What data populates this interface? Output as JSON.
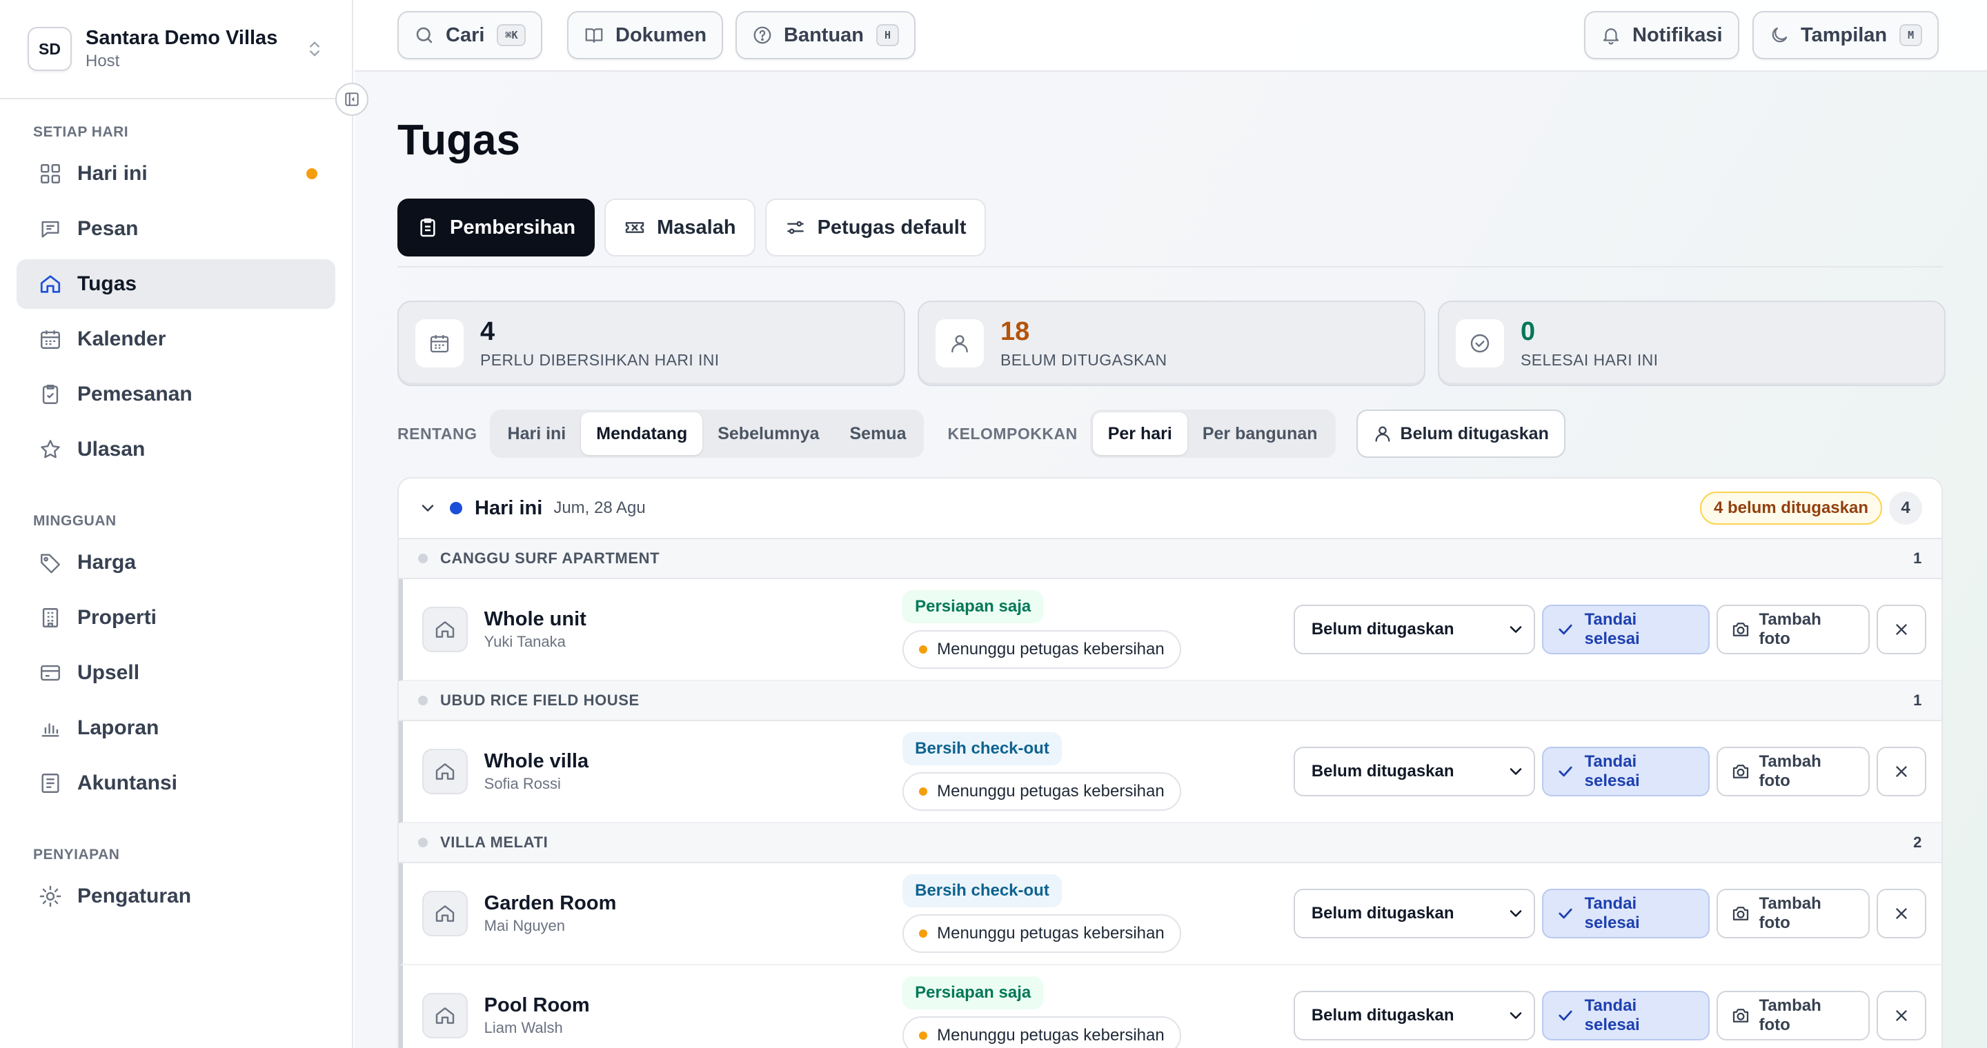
{
  "workspace": {
    "initials": "SD",
    "name": "Santara Demo Villas",
    "role": "Host"
  },
  "sidebar": {
    "sections": [
      {
        "heading": "SETIAP HARI",
        "items": [
          {
            "label": "Hari ini",
            "icon": "grid-icon",
            "dot": true
          },
          {
            "label": "Pesan",
            "icon": "message-icon"
          },
          {
            "label": "Tugas",
            "icon": "home-icon",
            "active": true
          },
          {
            "label": "Kalender",
            "icon": "calendar-icon"
          },
          {
            "label": "Pemesanan",
            "icon": "clipboard-check-icon"
          },
          {
            "label": "Ulasan",
            "icon": "star-icon"
          }
        ]
      },
      {
        "heading": "MINGGUAN",
        "items": [
          {
            "label": "Harga",
            "icon": "tag-icon"
          },
          {
            "label": "Properti",
            "icon": "building-icon"
          },
          {
            "label": "Upsell",
            "icon": "card-icon"
          },
          {
            "label": "Laporan",
            "icon": "bar-chart-icon"
          },
          {
            "label": "Akuntansi",
            "icon": "ledger-icon"
          }
        ]
      },
      {
        "heading": "PENYIAPAN",
        "items": [
          {
            "label": "Pengaturan",
            "icon": "sun-gear-icon"
          }
        ]
      }
    ]
  },
  "topbar": {
    "search": {
      "label": "Cari",
      "kbd": "⌘K"
    },
    "docs": {
      "label": "Dokumen"
    },
    "help": {
      "label": "Bantuan",
      "kbd": "H"
    },
    "notifications": {
      "label": "Notifikasi"
    },
    "theme": {
      "label": "Tampilan",
      "kbd": "M"
    }
  },
  "page": {
    "title": "Tugas"
  },
  "tabs": [
    {
      "label": "Pembersihan",
      "icon": "clipboard-icon",
      "active": true
    },
    {
      "label": "Masalah",
      "icon": "ticket-icon"
    },
    {
      "label": "Petugas default",
      "icon": "sliders-icon"
    }
  ],
  "stats": [
    {
      "value": "4",
      "label": "PERLU DIBERSIHKAN HARI INI",
      "icon": "calendar-icon",
      "color": "#111827"
    },
    {
      "value": "18",
      "label": "BELUM DITUGASKAN",
      "icon": "user-icon",
      "color": "#b45309"
    },
    {
      "value": "0",
      "label": "SELESAI HARI INI",
      "icon": "check-circle-icon",
      "color": "#047857"
    }
  ],
  "filters": {
    "range_label": "RENTANG",
    "range_options": [
      "Hari ini",
      "Mendatang",
      "Sebelumnya",
      "Semua"
    ],
    "range_selected": "Mendatang",
    "group_label": "KELOMPOKKAN",
    "group_options": [
      "Per hari",
      "Per bangunan"
    ],
    "group_selected": "Per hari",
    "assignee_filter": "Belum ditugaskan"
  },
  "day_group": {
    "title": "Hari ini",
    "date": "Jum, 28 Agu",
    "unassigned_badge": "4 belum ditugaskan",
    "count": "4"
  },
  "properties": [
    {
      "name": "CANGGU SURF APARTMENT",
      "count": "1",
      "tasks": [
        {
          "unit": "Whole unit",
          "guest": "Yuki Tanaka",
          "type": "Persiapan saja",
          "type_kind": "prep",
          "status": "Menunggu petugas kebersihan"
        }
      ]
    },
    {
      "name": "UBUD RICE FIELD HOUSE",
      "count": "1",
      "tasks": [
        {
          "unit": "Whole villa",
          "guest": "Sofia Rossi",
          "type": "Bersih check-out",
          "type_kind": "checkout",
          "status": "Menunggu petugas kebersihan"
        }
      ]
    },
    {
      "name": "VILLA MELATI",
      "count": "2",
      "tasks": [
        {
          "unit": "Garden Room",
          "guest": "Mai Nguyen",
          "type": "Bersih check-out",
          "type_kind": "checkout",
          "status": "Menunggu petugas kebersihan"
        },
        {
          "unit": "Pool Room",
          "guest": "Liam Walsh",
          "type": "Persiapan saja",
          "type_kind": "prep",
          "status": "Menunggu petugas kebersihan"
        }
      ]
    }
  ],
  "task_actions": {
    "assignee_value": "Belum ditugaskan",
    "mark_done": "Tandai selesai",
    "add_photo": "Tambah foto"
  }
}
